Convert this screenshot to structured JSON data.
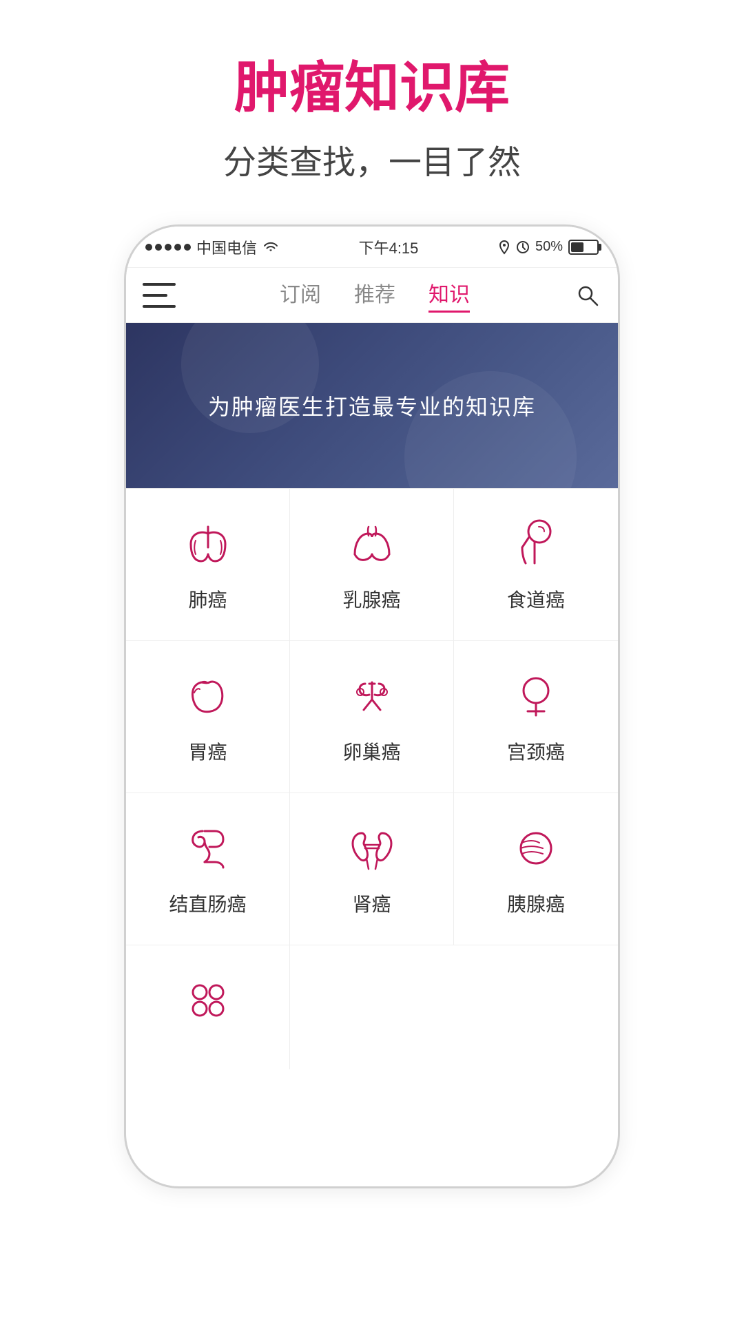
{
  "page": {
    "title": "肿瘤知识库",
    "subtitle": "分类查找，一目了然"
  },
  "statusBar": {
    "carrier": "中国电信",
    "wifi": "wifi",
    "time": "下午4:15",
    "battery": "50%"
  },
  "nav": {
    "tabs": [
      {
        "label": "订阅",
        "active": false
      },
      {
        "label": "推荐",
        "active": false
      },
      {
        "label": "知识",
        "active": true
      }
    ],
    "menu_label": "menu",
    "search_label": "search"
  },
  "banner": {
    "text": "为肿瘤医生打造最专业的知识库"
  },
  "categories": [
    {
      "id": "lung",
      "label": "肺癌",
      "icon": "lung"
    },
    {
      "id": "breast",
      "label": "乳腺癌",
      "icon": "breast"
    },
    {
      "id": "esophagus",
      "label": "食道癌",
      "icon": "esophagus"
    },
    {
      "id": "stomach",
      "label": "胃癌",
      "icon": "stomach"
    },
    {
      "id": "ovarian",
      "label": "卵巢癌",
      "icon": "ovarian"
    },
    {
      "id": "cervical",
      "label": "宫颈癌",
      "icon": "cervical"
    },
    {
      "id": "colorectal",
      "label": "结直肠癌",
      "icon": "colorectal"
    },
    {
      "id": "kidney",
      "label": "肾癌",
      "icon": "kidney"
    },
    {
      "id": "pancreatic",
      "label": "胰腺癌",
      "icon": "pancreatic"
    },
    {
      "id": "more",
      "label": "",
      "icon": "more"
    }
  ]
}
